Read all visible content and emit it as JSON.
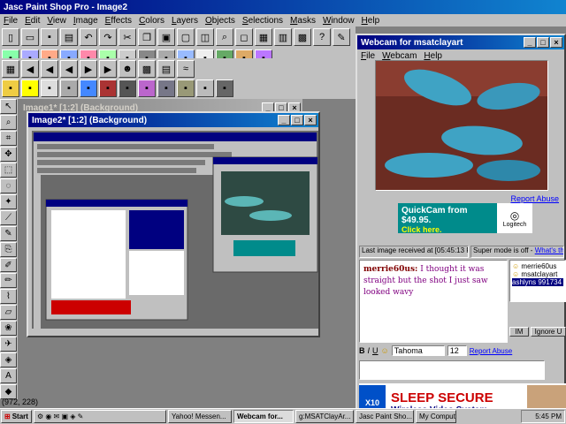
{
  "app": {
    "title": "Jasc Paint Shop Pro - Image2",
    "menu": [
      "File",
      "Edit",
      "View",
      "Image",
      "Effects",
      "Colors",
      "Layers",
      "Objects",
      "Selections",
      "Masks",
      "Window",
      "Help"
    ]
  },
  "image_windows": {
    "img1_title": "Image1* [1:2] (Background)",
    "img2_title": "Image2* [1:2] (Background)"
  },
  "webcam": {
    "title": "Webcam for msatclayart",
    "menu": [
      "File",
      "Webcam",
      "Help"
    ],
    "report_abuse": "Report Abuse",
    "ad_brand": "QuickCam",
    "ad_price": "from $49.95.",
    "ad_cta": "Click here.",
    "ad_logo": "Logitech",
    "last_image": "Last image received at [05:45:13 PM]",
    "super_mode": "Super mode is off -",
    "whats_this": "What's this?",
    "chat_user": "merrie60us:",
    "chat_message": "I thought it was straight but the shot I just saw looked wavy",
    "users": [
      "merrie60us",
      "msatclayart",
      "ashlyns 991734"
    ],
    "im_label": "IM",
    "ignore_label": "Ignore U",
    "font_name": "Tahoma",
    "font_size": "12",
    "report_abuse2": "Report Abuse",
    "ad2_title": "SLEEP SECURE",
    "ad2_sub": "Wireless Video System",
    "ad2_logo": "X10"
  },
  "status": {
    "coords": "(972, 228)"
  },
  "taskbar": {
    "start": "Start",
    "tasks": [
      "Yahoo! Messen...",
      "Webcam for...",
      "g:MSATClayAr...",
      "Jasc Paint Sho..."
    ],
    "my_computer": "My Computer",
    "clock": "5:45 PM"
  },
  "colors": {
    "title_active": "#000080",
    "face": "#c0c0c0",
    "ad_teal": "#008b8b",
    "ad_red": "#cc0000"
  }
}
